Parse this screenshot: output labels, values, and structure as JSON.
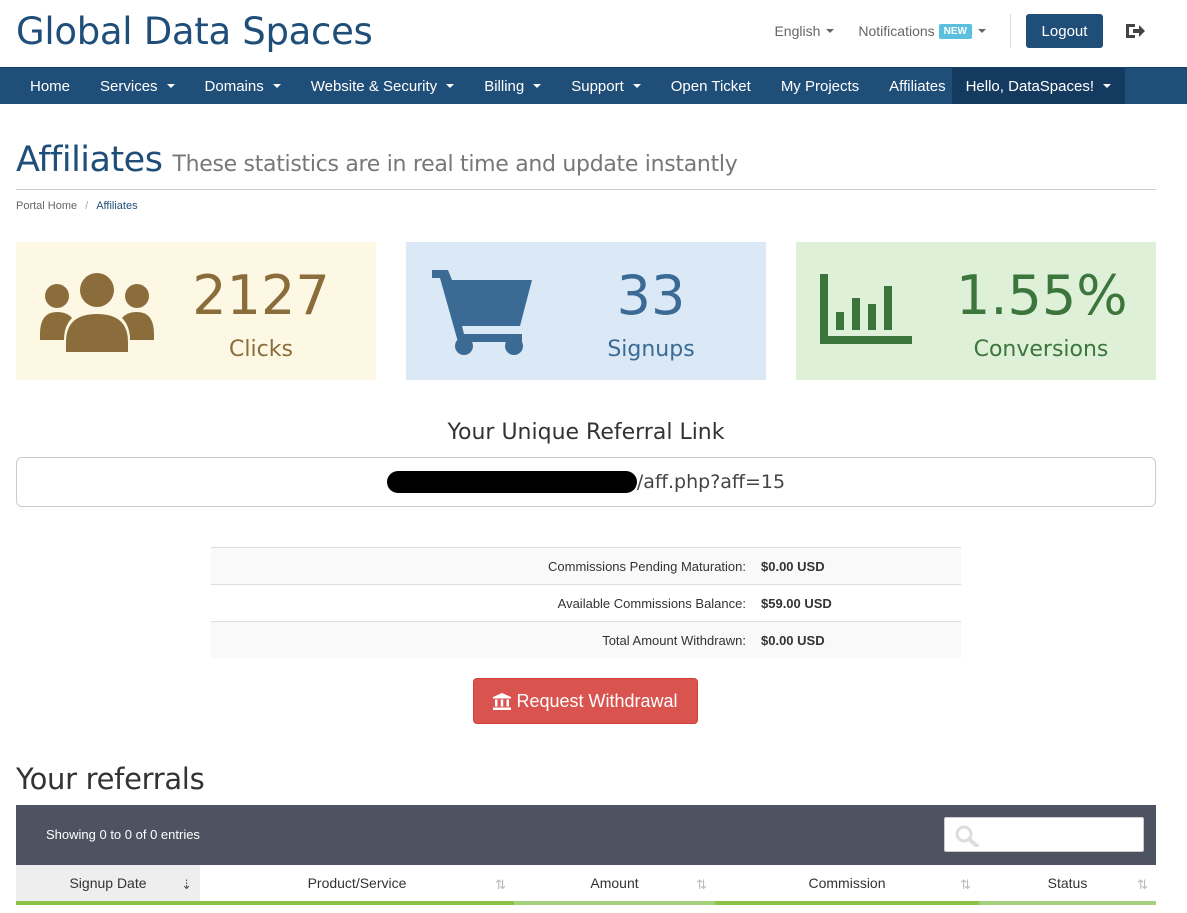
{
  "header": {
    "brand": "Global Data Spaces",
    "language": "English",
    "notifications": "Notifications",
    "notifications_badge": "NEW",
    "logout": "Logout"
  },
  "nav": {
    "items": [
      "Home",
      "Services",
      "Domains",
      "Website & Security",
      "Billing",
      "Support",
      "Open Ticket",
      "My Projects",
      "Affiliates"
    ],
    "user": "Hello, DataSpaces!"
  },
  "page": {
    "title": "Affiliates",
    "subtitle": "These statistics are in real time and update instantly",
    "breadcrumb": [
      "Portal Home",
      "Affiliates"
    ]
  },
  "stats": {
    "clicks": {
      "value": "2127",
      "label": "Clicks"
    },
    "signups": {
      "value": "33",
      "label": "Signups"
    },
    "conversions": {
      "value": "1.55%",
      "label": "Conversions"
    }
  },
  "colors": {
    "primary": "#1f4e79",
    "clicks_bg": "#fcf8e3",
    "signups_bg": "#dbe9f6",
    "conversions_bg": "#dff0d8",
    "danger": "#d9534f"
  },
  "referral": {
    "title": "Your Unique Referral Link",
    "link_suffix": "/aff.php?aff=15"
  },
  "commissions": [
    {
      "label": "Commissions Pending Maturation:",
      "value": "$0.00 USD"
    },
    {
      "label": "Available Commissions Balance:",
      "value": "$59.00 USD"
    },
    {
      "label": "Total Amount Withdrawn:",
      "value": "$0.00 USD"
    }
  ],
  "withdraw_label": "Request Withdrawal",
  "referrals": {
    "heading": "Your referrals",
    "info": "Showing 0 to 0 of 0 entries",
    "search_placeholder": "",
    "columns": [
      "Signup Date",
      "Product/Service",
      "Amount",
      "Commission",
      "Status"
    ]
  }
}
